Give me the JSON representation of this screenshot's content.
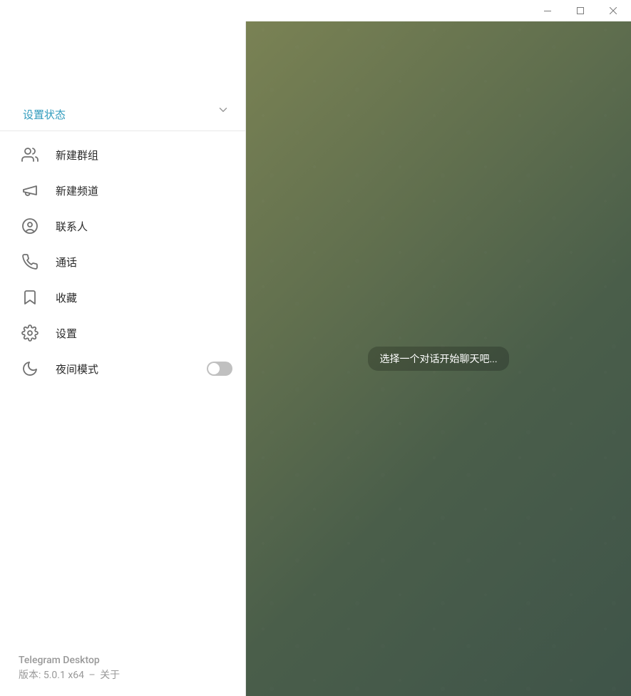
{
  "profile": {
    "status_link": "设置状态"
  },
  "menu": {
    "new_group": "新建群组",
    "new_channel": "新建频道",
    "contacts": "联系人",
    "calls": "通话",
    "saved": "收藏",
    "settings": "设置",
    "night_mode": "夜间模式"
  },
  "footer": {
    "app_name": "Telegram Desktop",
    "version_prefix": "版本: ",
    "version": "5.0.1 x64",
    "about": "关于"
  },
  "empty_state": "选择一个对话开始聊天吧..."
}
